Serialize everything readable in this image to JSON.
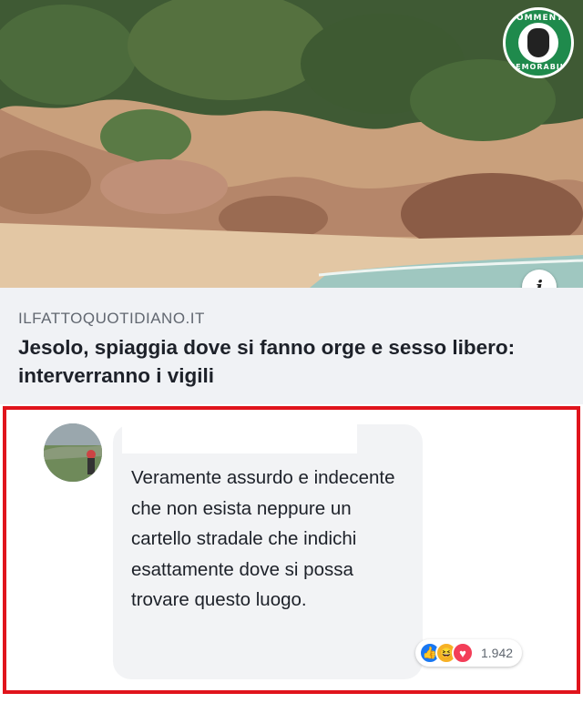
{
  "post": {
    "link_domain": "ILFATTOQUOTIDIANO.IT",
    "link_title": "Jesolo, spiaggia dove si fanno orge e sesso libero: interverranno i vigili",
    "info_icon": "i"
  },
  "watermark": {
    "top_text": "COMMENTI",
    "bottom_text": "MEMORABILI",
    "icon": "bearded-face-logo"
  },
  "comment": {
    "text": "Veramente assurdo e indecente che non esista neppure un cartello stradale che indichi esattamente dove si possa trovare questo luogo.",
    "reaction_count": "1.942",
    "reactions": [
      "like-icon",
      "haha-icon",
      "love-icon"
    ]
  },
  "colors": {
    "highlight_border": "#e0141c",
    "like": "#1877f2",
    "love": "#f33e58",
    "haha": "#f7b125",
    "bubble": "#f2f3f5"
  }
}
